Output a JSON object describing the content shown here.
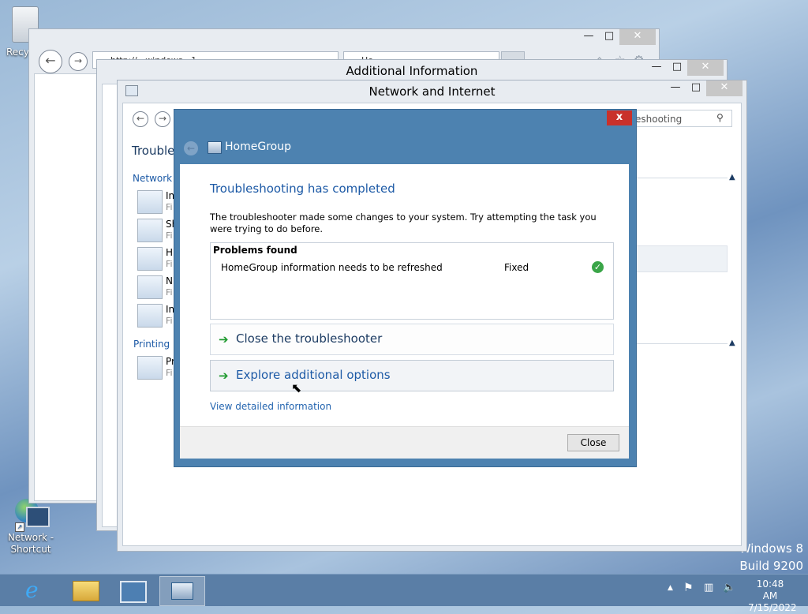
{
  "desktop": {
    "recycle_label": "Recy",
    "network_shortcut_label": "Network - Shortcut",
    "watermark_line1": "Windows 8",
    "watermark_line2": "Build 9200"
  },
  "ie_window": {
    "address": "http://...windows...1",
    "tab_label": "Ho..."
  },
  "additional_info_window": {
    "title": "Additional Information"
  },
  "network_window": {
    "title": "Network and Internet",
    "search_placeholder": "eshooting",
    "heading": "Trouble",
    "section_network": "Network",
    "section_printing": "Printing",
    "items": [
      {
        "label": "In",
        "sub": "Fi"
      },
      {
        "label": "Sh",
        "sub": "Fi"
      },
      {
        "label": "H",
        "sub": "Fi"
      },
      {
        "label": "N",
        "sub": "Fi"
      },
      {
        "label": "In",
        "sub": "Fi"
      }
    ],
    "printing_items": [
      {
        "label": "Pr",
        "sub": "Fi"
      }
    ]
  },
  "dialog": {
    "header_title": "HomeGroup",
    "heading": "Troubleshooting has completed",
    "description": "The troubleshooter made some changes to your system. Try attempting the task you were trying to do before.",
    "problems_header": "Problems found",
    "problems": [
      {
        "text": "HomeGroup information needs to be refreshed",
        "status": "Fixed"
      }
    ],
    "option_close": "Close the troubleshooter",
    "option_explore": "Explore additional options",
    "detail_link": "View detailed information",
    "close_button": "Close",
    "close_x": "x"
  },
  "taskbar": {
    "time": "10:48 AM",
    "date": "7/15/2022"
  },
  "colors": {
    "dialog_frame": "#4d82b0",
    "heading_blue": "#1d5aa6",
    "link_blue": "#2465b0",
    "close_red": "#c9312b",
    "check_green": "#3aa548"
  }
}
